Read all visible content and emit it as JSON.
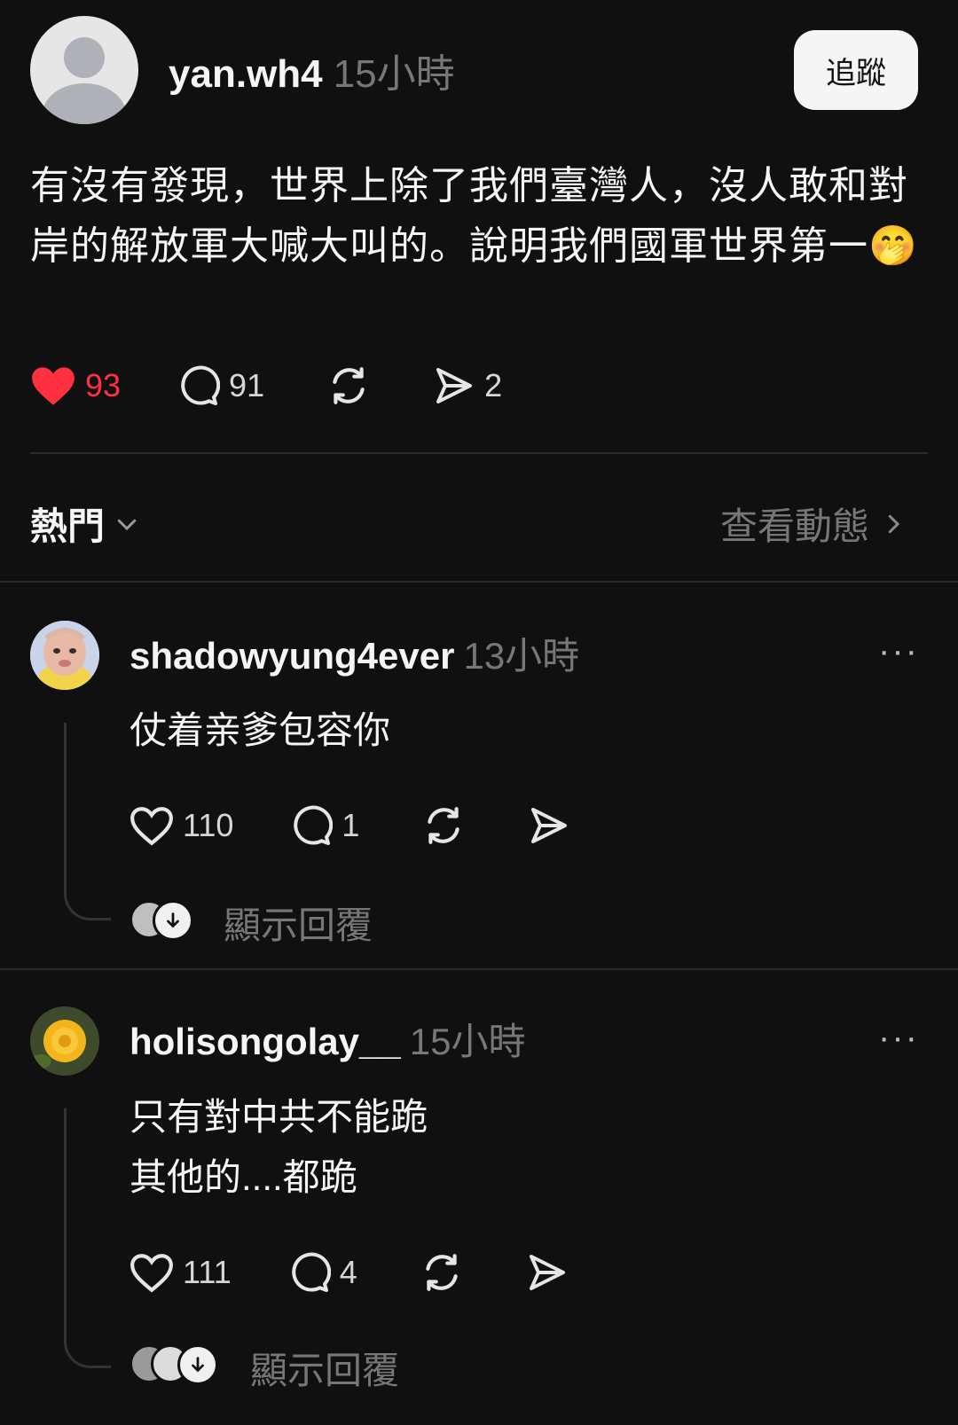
{
  "post": {
    "author": "yan.wh4",
    "time": "15小時",
    "follow_label": "追蹤",
    "text": "有沒有發現，世界上除了我們臺灣人，沒人敢和對岸的解放軍大喊大叫的。說明我們國軍世界第一🤭",
    "likes": "93",
    "comments": "91",
    "shares": "2",
    "like_color": "#ff3040"
  },
  "controls": {
    "sort_label": "熱門",
    "activity_label": "查看動態"
  },
  "comments": [
    {
      "author": "shadowyung4ever",
      "time": "13小時",
      "more": "···",
      "text": "仗着亲爹包容你",
      "likes": "110",
      "replies": "1",
      "show_replies": "顯示回覆"
    },
    {
      "author": "holisongolay__",
      "time": "15小時",
      "more": "···",
      "text_line1": "只有對中共不能跪",
      "text_line2": "其他的....都跪",
      "likes": "111",
      "replies": "4",
      "show_replies": "顯示回覆"
    }
  ]
}
